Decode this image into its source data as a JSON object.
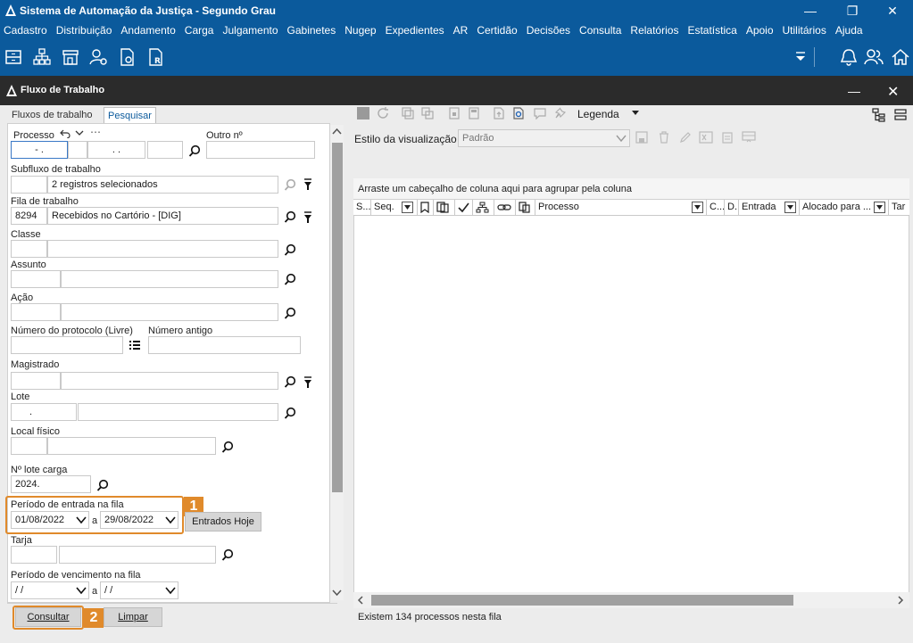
{
  "window": {
    "title": "Sistema de Automação da Justiça - Segundo Grau"
  },
  "menu": [
    "Cadastro",
    "Distribuição",
    "Andamento",
    "Carga",
    "Julgamento",
    "Gabinetes",
    "Nugep",
    "Expedientes",
    "AR",
    "Certidão",
    "Decisões",
    "Consulta",
    "Relatórios",
    "Estatística",
    "Apoio",
    "Utilitários",
    "Ajuda"
  ],
  "subwindow": {
    "title": "Fluxo de Trabalho"
  },
  "tabs": {
    "fluxos": "Fluxos de trabalho",
    "pesquisar": "Pesquisar"
  },
  "form": {
    "processo_label": "Processo",
    "processo_sep": "-   .",
    "processo_sep2": ".   .",
    "outro_label": "Outro nº",
    "subfluxo_label": "Subfluxo de trabalho",
    "subfluxo_value": "2 registros selecionados",
    "fila_label": "Fila de trabalho",
    "fila_code": "8294",
    "fila_value": "Recebidos no Cartório - [DIG]",
    "classe_label": "Classe",
    "assunto_label": "Assunto",
    "acao_label": "Ação",
    "protocolo_label": "Número do protocolo (Livre)",
    "numero_antigo_label": "Número antigo",
    "magistrado_label": "Magistrado",
    "lote_label": "Lote",
    "lote_value": ".",
    "local_label": "Local físico",
    "lote_carga_label": "Nº lote carga",
    "lote_carga_value": "2024.",
    "periodo_label": "Período de entrada na fila",
    "periodo_from": "01/08/2022",
    "periodo_sep": "a",
    "periodo_to": "29/08/2022",
    "entrados_hoje": "Entrados Hoje",
    "tarja_label": "Tarja",
    "vencimento_label": "Período de vencimento na fila",
    "vencimento_from": " / /",
    "vencimento_sep": "a",
    "vencimento_to": " / /"
  },
  "badges": {
    "one": "1",
    "two": "2"
  },
  "buttons": {
    "consultar": "Consultar",
    "limpar": "Limpar"
  },
  "right": {
    "legenda": "Legenda",
    "estilo_label": "Estilo da visualização",
    "estilo_value": "Padrão",
    "group_hint": "Arraste um cabeçalho de coluna aqui para agrupar pela coluna",
    "columns": {
      "s": "S...",
      "seq": "Seq.",
      "processo": "Processo",
      "c": "C...",
      "d": "D.",
      "entrada": "Entrada",
      "alocado": "Alocado para ...",
      "tar": "Tar"
    },
    "status": "Existem 134 processos nesta fila"
  },
  "colors": {
    "brand": "#0b5a9c",
    "accent": "#e08a2b",
    "header_dark": "#2b2b2b"
  }
}
